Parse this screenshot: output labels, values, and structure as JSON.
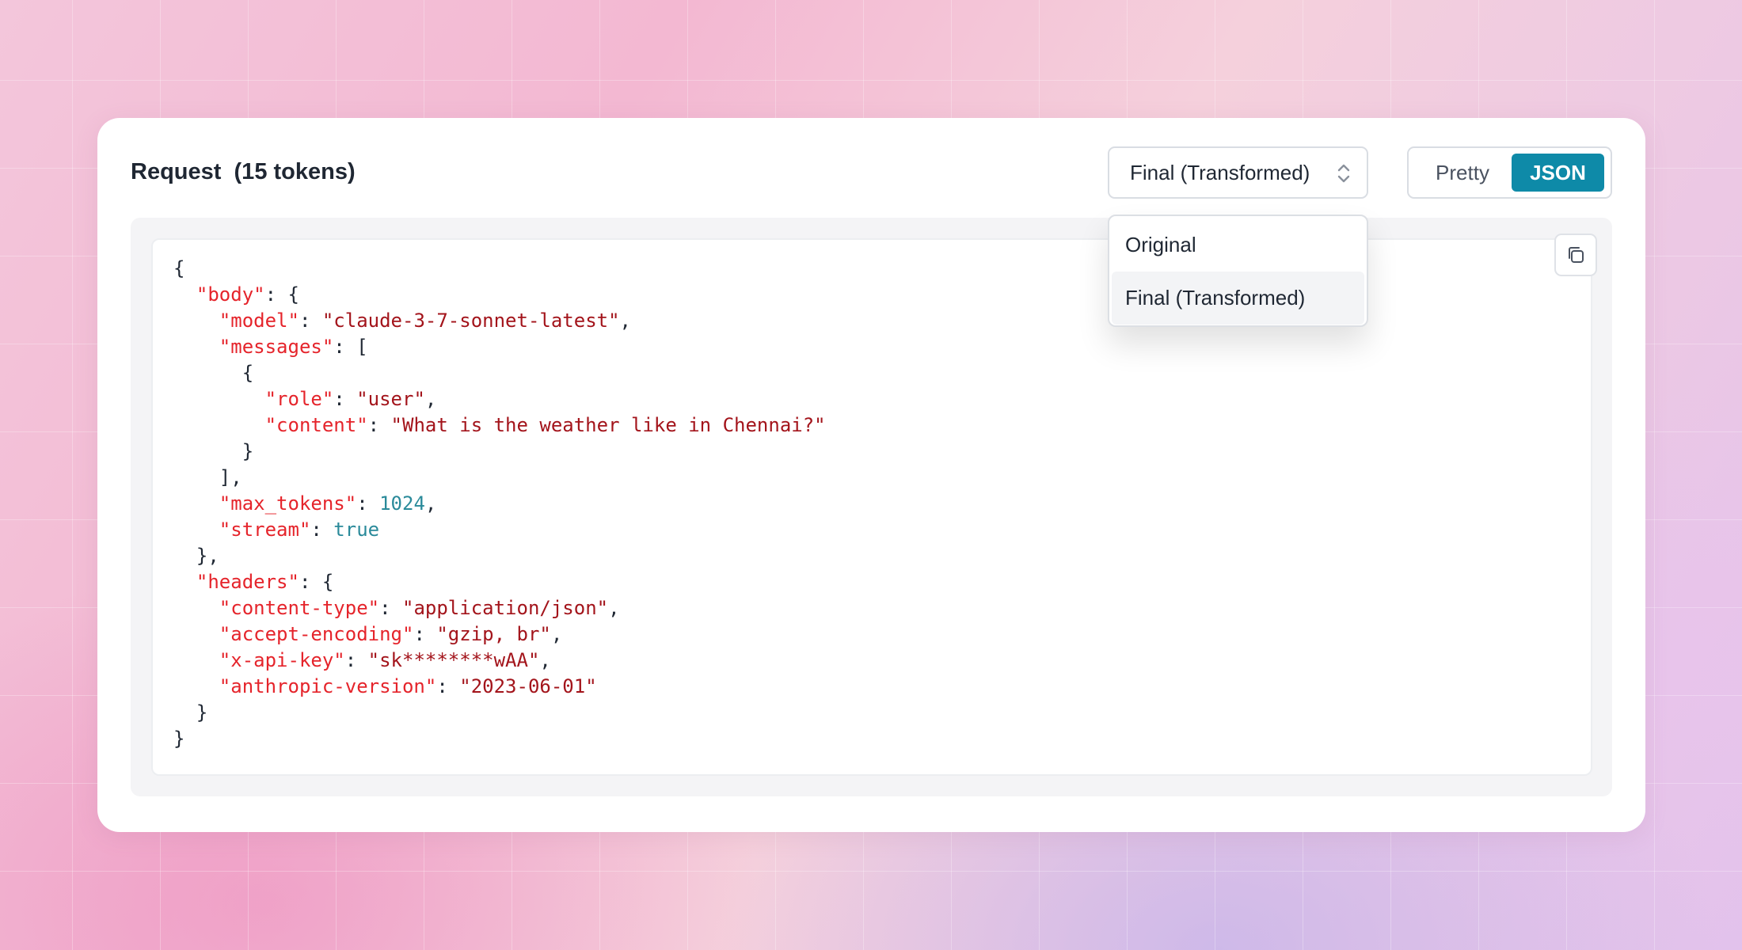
{
  "panel": {
    "title": "Request  (15 tokens)"
  },
  "view_select": {
    "selected": "Final (Transformed)",
    "options": [
      "Original",
      "Final (Transformed)"
    ]
  },
  "format_toggle": {
    "pretty_label": "Pretty",
    "json_label": "JSON",
    "active": "JSON"
  },
  "code": {
    "l1": "{",
    "l2_key": "\"body\"",
    "l2_rest": ": {",
    "l3_key": "\"model\"",
    "l3_val": "\"claude-3-7-sonnet-latest\"",
    "l4_key": "\"messages\"",
    "l4_rest": ": [",
    "l5": "{",
    "l6_key": "\"role\"",
    "l6_val": "\"user\"",
    "l7_key": "\"content\"",
    "l7_val": "\"What is the weather like in Chennai?\"",
    "l8": "}",
    "l9": "],",
    "l10_key": "\"max_tokens\"",
    "l10_val": "1024",
    "l11_key": "\"stream\"",
    "l11_val": "true",
    "l12": "},",
    "l13_key": "\"headers\"",
    "l13_rest": ": {",
    "l14_key": "\"content-type\"",
    "l14_val": "\"application/json\"",
    "l15_key": "\"accept-encoding\"",
    "l15_val": "\"gzip, br\"",
    "l16_key": "\"x-api-key\"",
    "l16_val": "\"sk********wAA\"",
    "l17_key": "\"anthropic-version\"",
    "l17_val": "\"2023-06-01\"",
    "l18": "}",
    "l19": "}"
  },
  "icons": {
    "copy": "copy-icon",
    "chevron": "chevron-up-down-icon"
  },
  "colors": {
    "accent": "#0e8aa8",
    "json_key": "#e5242b",
    "json_string": "#a3141b",
    "json_literal": "#2a8a9a"
  }
}
